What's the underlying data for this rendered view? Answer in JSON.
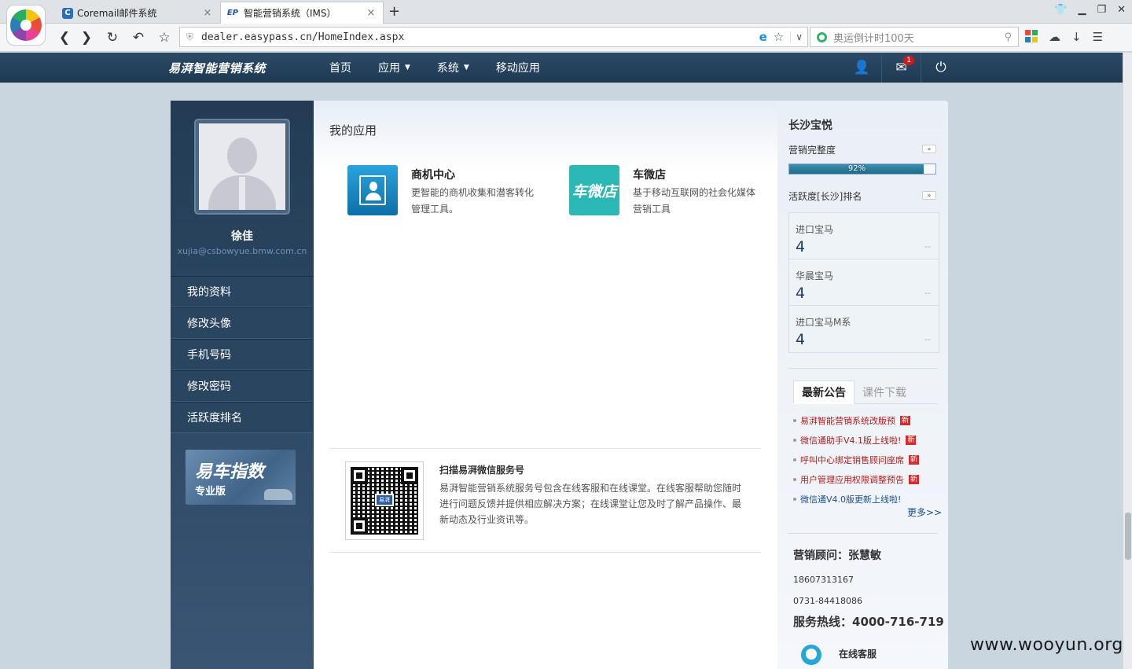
{
  "browser": {
    "tabs": [
      {
        "title": "Coremail邮件系统",
        "close": "×"
      },
      {
        "title": "智能营销系统（IMS）",
        "close": "×"
      }
    ],
    "new_tab": "+",
    "url": "dealer.easypass.cn/HomeIndex.aspx",
    "search_placeholder": "奥运倒计时100天"
  },
  "header": {
    "logo": "易湃智能营销系统",
    "menu": [
      {
        "label": "首页",
        "has_caret": false
      },
      {
        "label": "应用",
        "has_caret": true
      },
      {
        "label": "系统",
        "has_caret": true
      },
      {
        "label": "移动应用",
        "has_caret": false
      }
    ],
    "mail_badge": "1"
  },
  "profile": {
    "name": "徐佳",
    "email": "xujia@csbowyue.bmw.com.cn",
    "menu": [
      "我的资料",
      "修改头像",
      "手机号码",
      "修改密码",
      "活跃度排名"
    ],
    "banner_title": "易车指数",
    "banner_subtitle": "专业版"
  },
  "main": {
    "title": "我的应用",
    "apps": [
      {
        "name": "商机中心",
        "desc": "更智能的商机收集和潜客转化管理工具。"
      },
      {
        "name": "车微店",
        "icon_text": "车微店",
        "desc": "基于移动互联网的社会化媒体营销工具"
      }
    ],
    "qr": {
      "title": "扫描易湃微信服务号",
      "logo_text": "易湃",
      "desc": "易湃智能营销系统服务号包含在线客服和在线课堂。在线客服帮助您随时进行问题反馈并提供相应解决方案；在线课堂让您及时了解产品操作、最新动态及行业资讯等。"
    }
  },
  "sidebar_right": {
    "dealer": "长沙宝悦",
    "completeness_label": "营销完整度",
    "completeness_percent": 92,
    "completeness_text": "92%",
    "activity_label": "活跃度[长沙]排名",
    "more_btn": "»",
    "rankings": [
      {
        "name": "进口宝马",
        "value": "4",
        "trend": "--"
      },
      {
        "name": "华晨宝马",
        "value": "4",
        "trend": "--"
      },
      {
        "name": "进口宝马M系",
        "value": "4",
        "trend": "--"
      }
    ],
    "tabs": [
      "最新公告",
      "课件下载"
    ],
    "notices": [
      {
        "text": "易湃智能营销系统改版预",
        "is_new": true,
        "color": "red"
      },
      {
        "text": "微信通助手V4.1版上线啦!",
        "is_new": true,
        "color": "red"
      },
      {
        "text": "呼叫中心绑定销售顾问座席",
        "is_new": true,
        "color": "red"
      },
      {
        "text": "用户管理应用权限调整预告",
        "is_new": true,
        "color": "red"
      },
      {
        "text": "微信通V4.0版更新上线啦!",
        "is_new": false,
        "color": "blue"
      }
    ],
    "new_tag": "新",
    "more_link": "更多>>",
    "advisor": "营销顾问：张慧敏",
    "phones": [
      "18607313167",
      "0731-84418086"
    ],
    "hotline": "服务热线：4000-716-719",
    "online_service": "在线客服"
  },
  "watermark": "www.wooyun.org",
  "colors": {
    "header_bg": "#1f3a54",
    "accent_red": "#b01c1c",
    "link_blue": "#1d4f8c"
  }
}
